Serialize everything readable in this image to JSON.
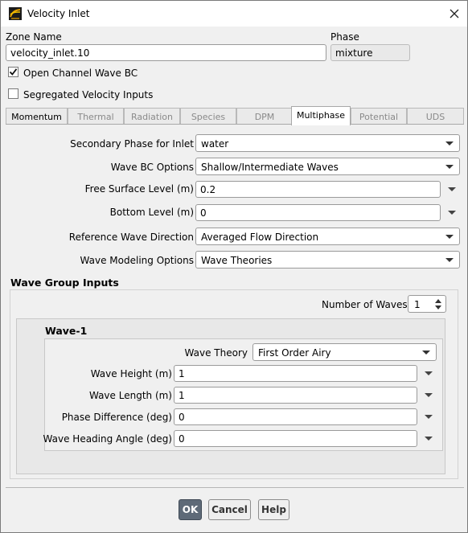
{
  "window": {
    "title": "Velocity Inlet"
  },
  "zone": {
    "label": "Zone Name",
    "value": "velocity_inlet.10"
  },
  "phase": {
    "label": "Phase",
    "value": "mixture"
  },
  "options": {
    "open_channel": {
      "label": "Open Channel Wave BC",
      "checked": true
    },
    "segregated": {
      "label": "Segregated Velocity Inputs",
      "checked": false
    }
  },
  "tabs": [
    {
      "label": "Momentum",
      "active": false
    },
    {
      "label": "Thermal",
      "active": false
    },
    {
      "label": "Radiation",
      "active": false
    },
    {
      "label": "Species",
      "active": false
    },
    {
      "label": "DPM",
      "active": false
    },
    {
      "label": "Multiphase",
      "active": true
    },
    {
      "label": "Potential",
      "active": false
    },
    {
      "label": "UDS",
      "active": false
    }
  ],
  "multiphase": {
    "secondary_phase": {
      "label": "Secondary Phase for Inlet",
      "value": "water"
    },
    "wave_bc": {
      "label": "Wave BC Options",
      "value": "Shallow/Intermediate Waves"
    },
    "free_surface": {
      "label": "Free Surface Level (m)",
      "value": "0.2"
    },
    "bottom_level": {
      "label": "Bottom Level (m)",
      "value": "0"
    },
    "ref_direction": {
      "label": "Reference Wave Direction",
      "value": "Averaged Flow Direction"
    },
    "modeling": {
      "label": "Wave Modeling Options",
      "value": "Wave Theories"
    }
  },
  "wave_group": {
    "title": "Wave Group Inputs",
    "num_waves": {
      "label": "Number of Waves",
      "value": "1"
    },
    "wave1": {
      "title": "Wave-1",
      "theory": {
        "label": "Wave Theory",
        "value": "First Order Airy"
      },
      "height": {
        "label": "Wave Height (m)",
        "value": "1"
      },
      "length": {
        "label": "Wave Length (m)",
        "value": "1"
      },
      "phase_diff": {
        "label": "Phase Difference (deg)",
        "value": "0"
      },
      "heading": {
        "label": "Wave Heading Angle (deg)",
        "value": "0"
      }
    }
  },
  "buttons": {
    "ok": "OK",
    "cancel": "Cancel",
    "help": "Help"
  },
  "icons": {
    "app": "ansys-fluent-icon",
    "close": "close-icon",
    "check": "checkmark-icon",
    "dropdown": "chevron-down-icon"
  }
}
